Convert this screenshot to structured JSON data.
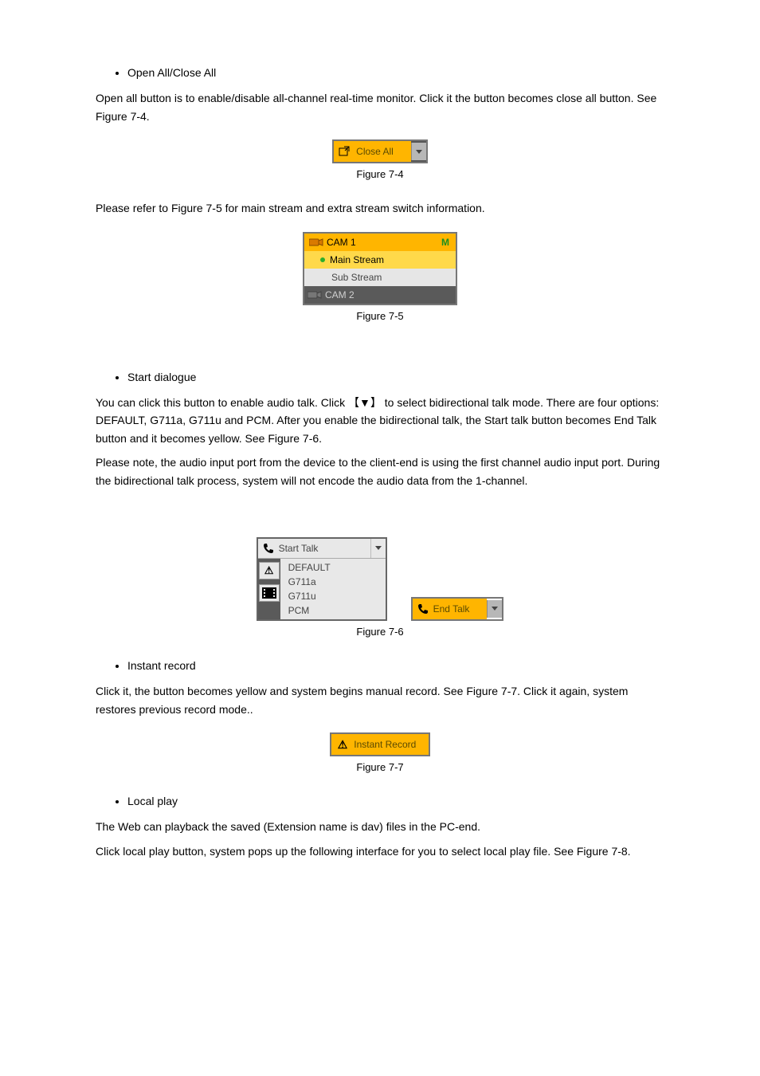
{
  "section1": {
    "bullets": [
      "Open All/Close All"
    ],
    "para1": "Open all button is to enable/disable all-channel real-time monitor. Click it the button becomes close all button. See Figure 7-4."
  },
  "fig4": {
    "button_label": "Close All",
    "caption": "Figure 7-4"
  },
  "section2": {
    "para1": "Please refer to Figure 7-5 for main stream and extra stream switch information."
  },
  "fig5": {
    "cam1": "CAM 1",
    "cam1_badge": "M",
    "main_stream": "Main Stream",
    "sub_stream": "Sub Stream",
    "cam2": "CAM 2",
    "caption": "Figure 7-5"
  },
  "section3": {
    "bullets": [
      "Start dialogue"
    ],
    "para1": "You can click this button to enable audio talk. Click 【▼】 to select bidirectional talk mode. There are four options: DEFAULT, G711a, G711u and PCM. After you enable the bidirectional talk, the Start talk button becomes End Talk button and it becomes yellow. See Figure 7-6.",
    "para2": "Please note, the audio input port from the device to the client-end is using the first channel audio input port. During the bidirectional talk process, system will not encode the audio data from the 1-channel."
  },
  "fig6": {
    "start_talk": "Start Talk",
    "menu": [
      "DEFAULT",
      "G711a",
      "G711u",
      "PCM"
    ],
    "end_talk": "End Talk",
    "caption": "Figure 7-6"
  },
  "section4": {
    "bullets": [
      "Instant record"
    ],
    "para1": "Click it, the button becomes yellow and system begins manual record. See Figure 7-7. Click it again, system restores previous record mode.."
  },
  "fig7": {
    "button_label": "Instant Record",
    "caption": "Figure 7-7"
  },
  "section5": {
    "bullets": [
      "Local play"
    ],
    "para1": "The Web can playback the saved (Extension name is dav) files in the PC-end.",
    "para2": "Click local play button, system pops up the following interface for you to select local play file. See Figure 7-8."
  }
}
